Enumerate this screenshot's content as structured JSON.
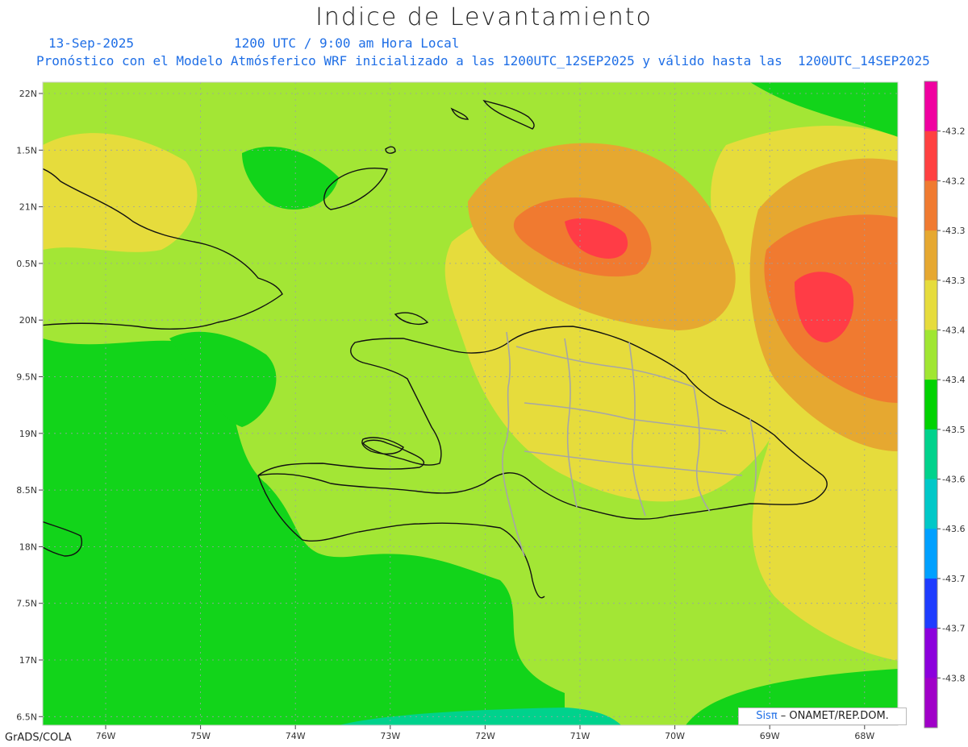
{
  "title": "Indice de Levantamiento",
  "date": "13-Sep-2025",
  "time": "1200 UTC / 9:00 am Hora Local",
  "subtitle": "Pronóstico con el Modelo Atmósferico WRF inicializado a las 1200UTC_12SEP2025 y válido hasta las  1200UTC_14SEP2025",
  "footer": "GrADS/COLA",
  "credit": {
    "logo": "Sisπ",
    "text": " – ONAMET/REP.DOM."
  },
  "map_data": {
    "lon_ticks": [
      "76W",
      "75W",
      "74W",
      "73W",
      "72W",
      "71W",
      "70W",
      "69W",
      "68W"
    ],
    "lat_ticks": [
      "22N",
      "1.5N",
      "21N",
      "0.5N",
      "20N",
      "9.5N",
      "19N",
      "8.5N",
      "18N",
      "7.5N",
      "17N",
      "6.5N"
    ],
    "colorbar": {
      "labels": [
        "-43.2",
        "-43.2",
        "-43.3",
        "-43.3",
        "-43.4",
        "-43.4",
        "-43.5",
        "-43.6",
        "-43.6",
        "-43.7",
        "-43.7",
        "-43.8"
      ],
      "colors": [
        "#f000a0",
        "#ff4040",
        "#f07a30",
        "#e6a830",
        "#e6dc3c",
        "#a0e632",
        "#00d200",
        "#00d28c",
        "#00c8c8",
        "#00a0ff",
        "#1e3cff",
        "#8c00dc",
        "#a000c8"
      ]
    },
    "field_colors": {
      "green": "#12d41a",
      "lightgreen": "#a3e635",
      "yellow": "#e6dc3c",
      "gold": "#e6a830",
      "orange": "#f07a30",
      "red": "#ff3c46",
      "teal": "#00d28c"
    }
  }
}
